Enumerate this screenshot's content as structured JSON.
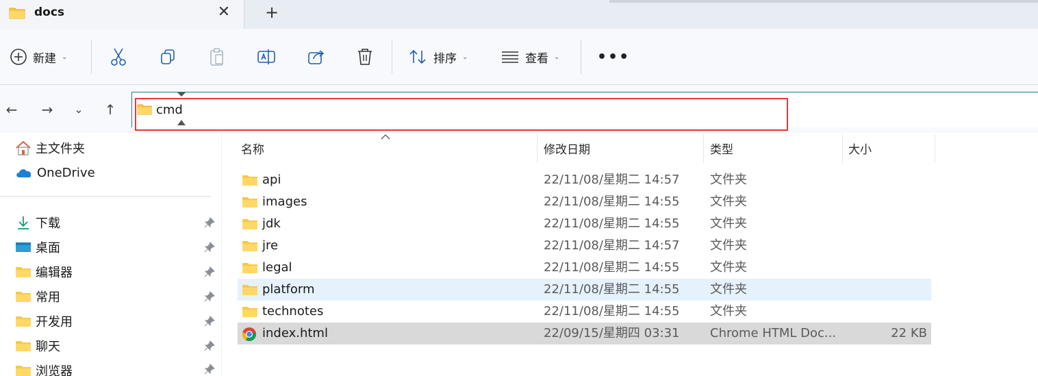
{
  "tab": {
    "title": "docs",
    "close": "✕",
    "new": "+"
  },
  "toolbar": {
    "new_label": "新建",
    "sort_label": "排序",
    "view_label": "查看",
    "more": "•••"
  },
  "address": {
    "path": "cmd"
  },
  "sidebar": {
    "top": [
      {
        "label": "主文件夹"
      },
      {
        "label": "OneDrive"
      }
    ],
    "pinned": [
      {
        "label": "下载"
      },
      {
        "label": "桌面"
      },
      {
        "label": "编辑器"
      },
      {
        "label": "常用"
      },
      {
        "label": "开发用"
      },
      {
        "label": "聊天"
      },
      {
        "label": "浏览器"
      }
    ]
  },
  "columns": {
    "name": "名称",
    "date": "修改日期",
    "type": "类型",
    "size": "大小"
  },
  "files": [
    {
      "name": "api",
      "date": "22/11/08/星期二 14:57",
      "type": "文件夹",
      "size": ""
    },
    {
      "name": "images",
      "date": "22/11/08/星期二 14:55",
      "type": "文件夹",
      "size": ""
    },
    {
      "name": "jdk",
      "date": "22/11/08/星期二 14:55",
      "type": "文件夹",
      "size": ""
    },
    {
      "name": "jre",
      "date": "22/11/08/星期二 14:57",
      "type": "文件夹",
      "size": ""
    },
    {
      "name": "legal",
      "date": "22/11/08/星期二 14:55",
      "type": "文件夹",
      "size": ""
    },
    {
      "name": "platform",
      "date": "22/11/08/星期二 14:55",
      "type": "文件夹",
      "size": ""
    },
    {
      "name": "technotes",
      "date": "22/11/08/星期二 14:55",
      "type": "文件夹",
      "size": ""
    },
    {
      "name": "index.html",
      "date": "22/09/15/星期四 03:31",
      "type": "Chrome HTML Doc...",
      "size": "22 KB"
    }
  ],
  "colors": {
    "accent": "#1f7a8c",
    "highlight_box": "#e53935",
    "hover_row": "#e5f1fb",
    "selected_row": "#d9d9d9",
    "folder": "#f7c948"
  }
}
